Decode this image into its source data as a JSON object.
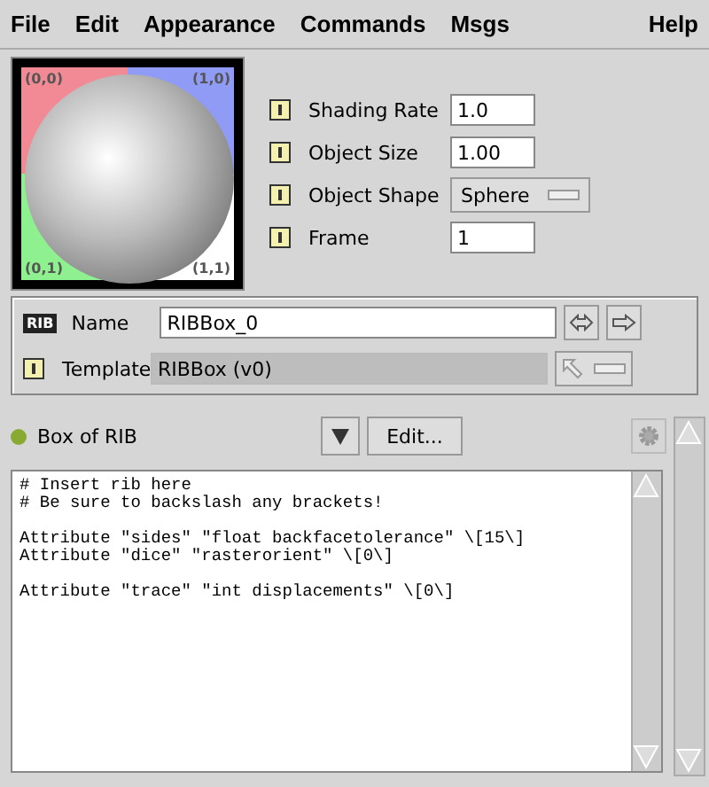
{
  "menu": [
    {
      "label": "File"
    },
    {
      "label": "Edit"
    },
    {
      "label": "Appearance"
    },
    {
      "label": "Commands"
    },
    {
      "label": "Msgs"
    }
  ],
  "help_menu": "Help",
  "preview": {
    "corners": [
      "(0,0)",
      "(1,0)",
      "(0,1)",
      "(1,1)"
    ]
  },
  "params": [
    {
      "kind": "text",
      "label": "Shading Rate",
      "value": "1.0"
    },
    {
      "kind": "text",
      "label": "Object Size",
      "value": "1.00"
    },
    {
      "kind": "choice",
      "label": "Object Shape",
      "value": "Sphere"
    },
    {
      "kind": "text",
      "label": "Frame",
      "value": "1"
    }
  ],
  "name_row": {
    "badge": "RIB",
    "label": "Name",
    "value": "RIBBox_0"
  },
  "template_row": {
    "label": "Template",
    "value": "RIBBox (v0)"
  },
  "section": {
    "title": "Box of RIB",
    "edit_button": "Edit..."
  },
  "code_blocks": [
    [
      "# Insert rib here",
      "# Be sure to backslash any brackets!"
    ],
    [
      "Attribute \"sides\" \"float backfacetolerance\" \\[15\\]",
      "Attribute \"dice\" \"rasterorient\" \\[0\\]"
    ],
    [
      "Attribute \"trace\" \"int displacements\" \\[0\\]"
    ]
  ]
}
